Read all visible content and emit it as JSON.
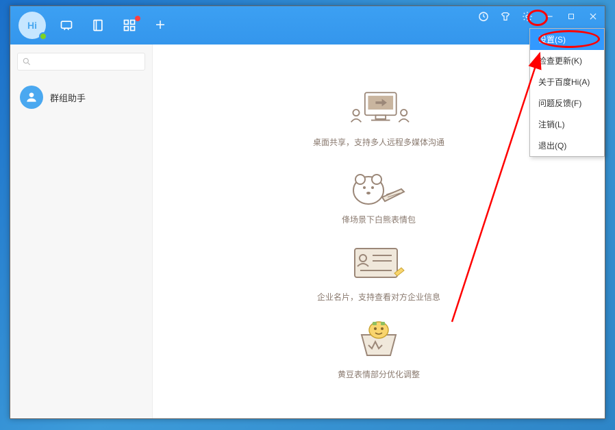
{
  "avatar_text": "Hi",
  "sidebar": {
    "item_label": "群组助手"
  },
  "features": [
    {
      "caption": "桌面共享，支持多人远程多媒体沟通"
    },
    {
      "caption": "佭场景下白熊表情包"
    },
    {
      "caption": "企业名片，支持查看对方企业信息"
    },
    {
      "caption": "黄豆表情部分优化调整"
    }
  ],
  "menu": {
    "settings": "设置(S)",
    "check_update": "检查更新(K)",
    "about": "关于百度Hi(A)",
    "feedback": "问题反馈(F)",
    "logout": "注销(L)",
    "exit": "退出(Q)"
  }
}
